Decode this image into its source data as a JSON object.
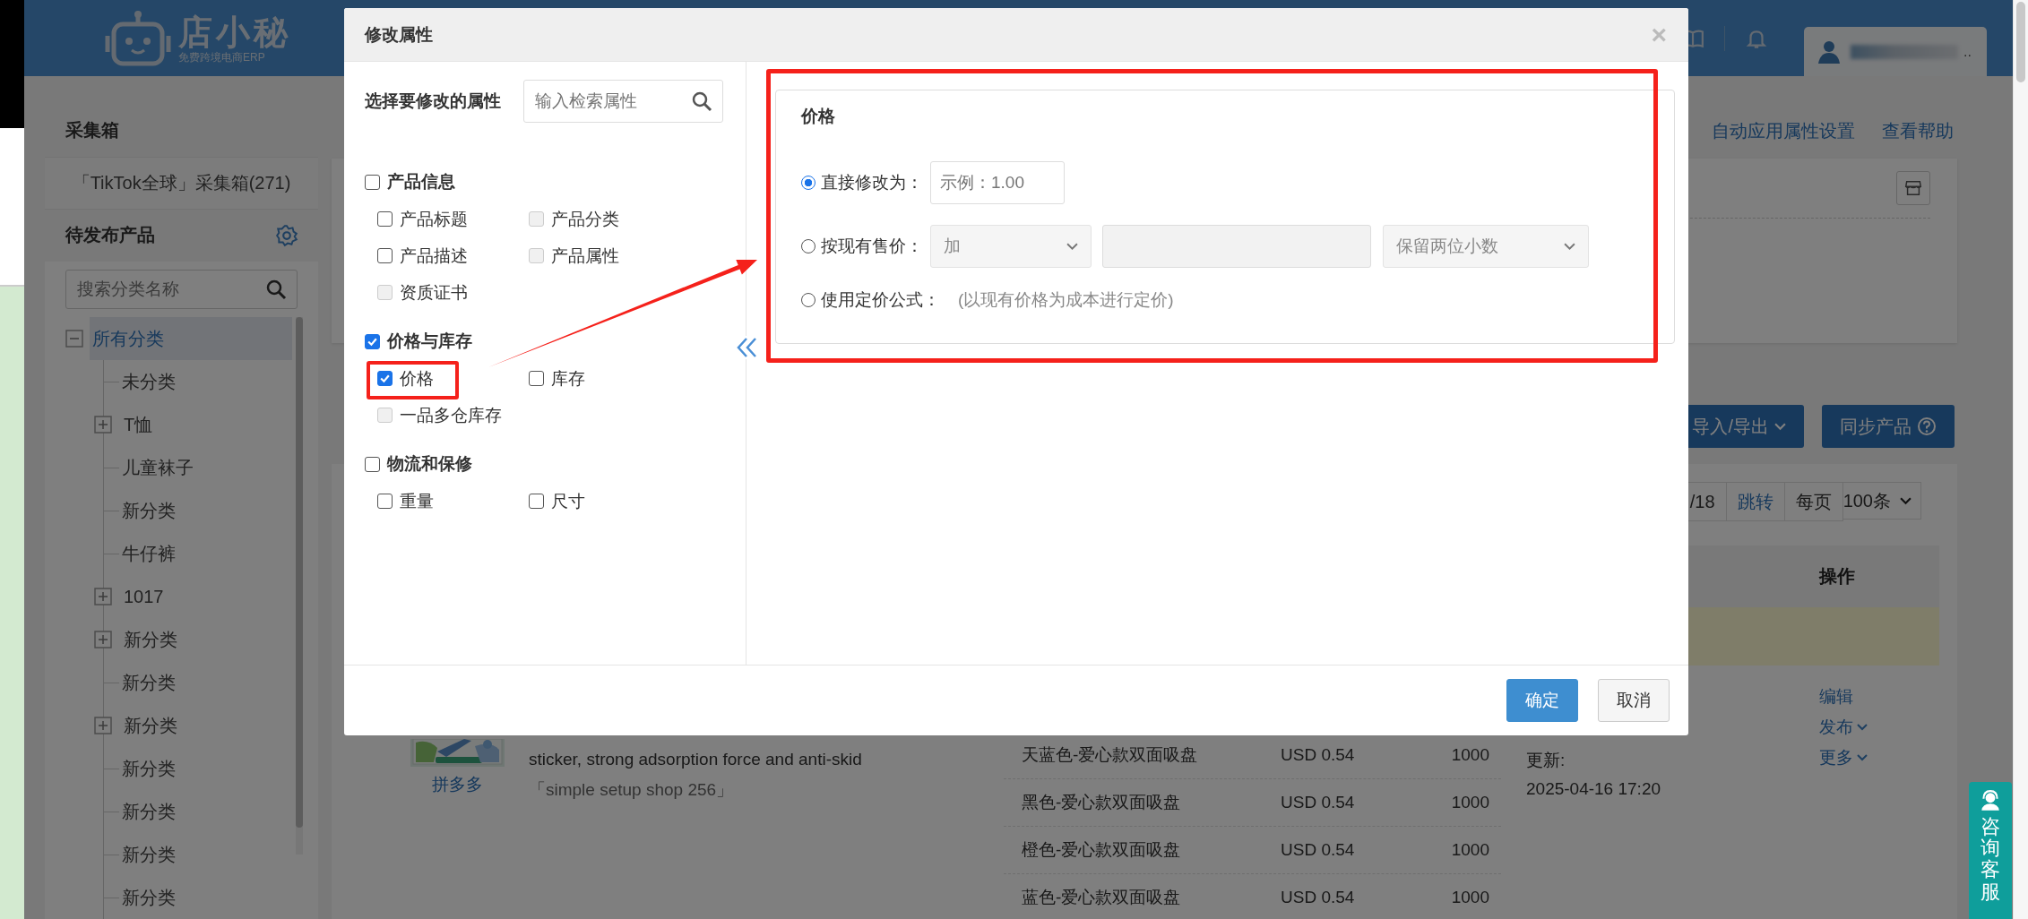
{
  "header": {
    "logo_text": "店小秘",
    "logo_subtitle": "免费跨境电商ERP",
    "user_suffix": ".."
  },
  "sidebar": {
    "collect_title": "采集箱",
    "collect_items": [
      {
        "label": "「TikTok全球」采集箱(271)"
      }
    ],
    "pending_title": "待发布产品",
    "search": {
      "placeholder": "搜索分类名称"
    },
    "tree": [
      {
        "label": "所有分类",
        "kind": "folder",
        "expanded": true,
        "selected": true,
        "children": [
          {
            "label": "未分类",
            "kind": "leaf",
            "selected": false
          },
          {
            "label": "T恤",
            "kind": "folder",
            "expanded": false,
            "selected": false
          },
          {
            "label": "儿童袜子",
            "kind": "leaf",
            "selected": false
          },
          {
            "label": "新分类",
            "kind": "leaf",
            "selected": false
          },
          {
            "label": "牛仔裤",
            "kind": "leaf",
            "selected": false
          },
          {
            "label": "1017",
            "kind": "folder",
            "expanded": false,
            "selected": false
          },
          {
            "label": "新分类",
            "kind": "folder",
            "expanded": false,
            "selected": false
          },
          {
            "label": "新分类",
            "kind": "leaf",
            "selected": false
          },
          {
            "label": "新分类",
            "kind": "folder",
            "expanded": false,
            "selected": false
          },
          {
            "label": "新分类",
            "kind": "leaf",
            "selected": false
          },
          {
            "label": "新分类",
            "kind": "leaf",
            "selected": false
          },
          {
            "label": "新分类",
            "kind": "leaf",
            "selected": false
          },
          {
            "label": "新分类",
            "kind": "leaf",
            "selected": false
          }
        ]
      }
    ]
  },
  "top_links": [
    "自动应用属性设置",
    "查看帮助"
  ],
  "toolbar_buttons": [
    {
      "label": "导入/导出",
      "kind": "dropdown"
    },
    {
      "label": "同步产品",
      "kind": "help"
    }
  ],
  "pagination": {
    "pages": "/18",
    "jump": "跳转",
    "per_page_label": "每页",
    "per_page": "100条"
  },
  "table": {
    "columns": [
      {
        "label": "操作"
      }
    ],
    "product": {
      "source": "拼多多",
      "title": "sticker, strong adsorption force and anti-skid",
      "shop": "「simple setup shop 256」",
      "variants": [
        {
          "name": "天蓝色-爱心款双面吸盘",
          "price": "USD 0.54",
          "stock": "1000"
        },
        {
          "name": "黑色-爱心款双面吸盘",
          "price": "USD 0.54",
          "stock": "1000"
        },
        {
          "name": "橙色-爱心款双面吸盘",
          "price": "USD 0.54",
          "stock": "1000"
        },
        {
          "name": "蓝色-爱心款双面吸盘",
          "price": "USD 0.54",
          "stock": "1000"
        }
      ],
      "updated_label": "更新:",
      "updated": "2025-04-16 17:20",
      "actions": [
        {
          "label": "编辑",
          "dropdown": false
        },
        {
          "label": "发布",
          "dropdown": true
        },
        {
          "label": "更多",
          "dropdown": true
        }
      ]
    }
  },
  "support_widget": {
    "label": "咨询客服"
  },
  "modal": {
    "title": "修改属性",
    "close": "×",
    "prompt": "选择要修改的属性",
    "search": {
      "placeholder": "输入检索属性"
    },
    "groups": [
      {
        "label": "产品信息",
        "checked": false,
        "items": [
          {
            "label": "产品标题",
            "checked": false,
            "disabled": false
          },
          {
            "label": "产品分类",
            "checked": false,
            "disabled": true
          },
          {
            "label": "产品描述",
            "checked": false,
            "disabled": false
          },
          {
            "label": "产品属性",
            "checked": false,
            "disabled": true
          },
          {
            "label": "资质证书",
            "checked": false,
            "disabled": true
          }
        ]
      },
      {
        "label": "价格与库存",
        "checked": true,
        "items": [
          {
            "label": "价格",
            "checked": true,
            "disabled": false
          },
          {
            "label": "库存",
            "checked": false,
            "disabled": false
          },
          {
            "label": "一品多仓库存",
            "checked": false,
            "disabled": true
          }
        ]
      },
      {
        "label": "物流和保修",
        "checked": false,
        "items": [
          {
            "label": "重量",
            "checked": false,
            "disabled": false
          },
          {
            "label": "尺寸",
            "checked": false,
            "disabled": false
          }
        ]
      }
    ],
    "panel": {
      "title": "价格",
      "options": [
        {
          "kind": "input",
          "label": "直接修改为：",
          "selected": true,
          "placeholder": "示例：1.00"
        },
        {
          "kind": "adjust",
          "label": "按现有售价：",
          "selected": false,
          "operation": "加",
          "rounding": "保留两位小数"
        },
        {
          "kind": "formula",
          "label": "使用定价公式：",
          "selected": false,
          "note": "(以现有价格为成本进行定价)"
        }
      ]
    },
    "buttons": [
      {
        "label": "确定",
        "kind": "primary"
      },
      {
        "label": "取消",
        "kind": "default"
      }
    ]
  }
}
